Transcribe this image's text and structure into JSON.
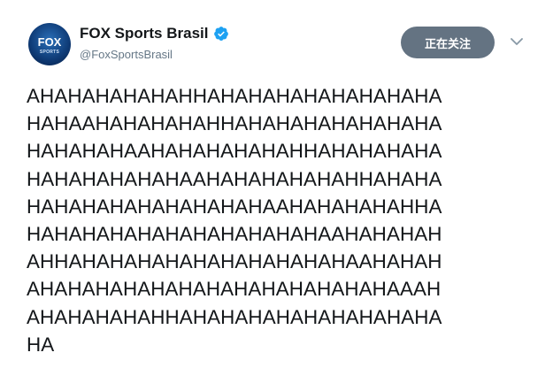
{
  "account": {
    "display_name": "FOX Sports Brasil",
    "handle": "@FoxSportsBrasil",
    "avatar_text": "FOX",
    "avatar_subtext": "SPORTS",
    "verified": true
  },
  "follow_button": {
    "label": "正在关注"
  },
  "tweet": {
    "lines": [
      "AHAHAHAHAHAHHAHAHAHAHAHAHAHAHA",
      "HAHAAHAHAHAHAHHAHAHAHAHAHAHAHA",
      "HAHAHAHAAHAHAHAHAHAHHAHAHAHAHA",
      "HAHAHAHAHAHAAHAHAHAHAHAHHAHAHA",
      "HAHAHAHAHAHAHAHAHAAHAHAHAHAHHA",
      "HAHAHAHAHAHAHAHAHAHAHAAHAHAHAH",
      "AHHAHAHAHAHAHAHAHAHAHAHAAHAHAH",
      "AHAHAHAHAHAHAHAHAHAHAHAHAHAAAH",
      "AHAHAHAHAHHAHAHAHAHAHAHAHAHAHA",
      "HA"
    ]
  },
  "colors": {
    "follow_button_bg": "#647382",
    "verified_blue": "#1da1f2",
    "handle_gray": "#657786",
    "text": "#14171a"
  },
  "icons": [
    "verified-badge-icon",
    "chevron-down-icon"
  ]
}
